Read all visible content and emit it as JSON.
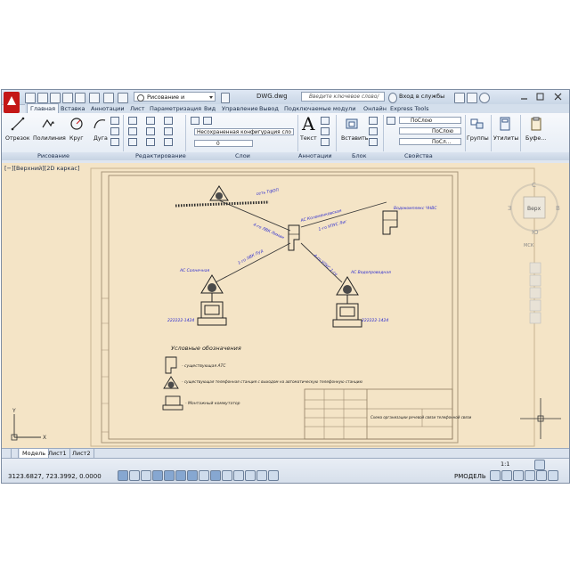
{
  "window": {
    "document_title": "DWG.dwg",
    "workspace": "Рисование и аннотации",
    "search_placeholder": "Введите ключевое слово/фразу",
    "login": "Вход в службы"
  },
  "tabs": [
    "Главная",
    "Вставка",
    "Аннотации",
    "Лист",
    "Параметризация",
    "Вид",
    "Управление",
    "Вывод",
    "Подключаемые модули",
    "Онлайн",
    "Express Tools"
  ],
  "ribbon": {
    "draw_tools": [
      "Отрезок",
      "Полилиния",
      "Круг",
      "Дуга"
    ],
    "layer_combo": "Несохраненная конфигурация сло",
    "layer_current": "0",
    "text_button": "Текст",
    "insert_button": "Вставить",
    "color_combo": "ПоСлою",
    "linetype_combo": "ПоСлою",
    "lineweight_combo": "ПоСл...",
    "groups_button": "Группы",
    "utilities_button": "Утилиты",
    "clipboard_button": "Буфе...",
    "panels": [
      "Рисование",
      "Редактирование",
      "Слои",
      "Аннотации",
      "Блок",
      "Свойства"
    ]
  },
  "viewport": {
    "label": "[−][Верхний][2D каркас]",
    "viewcube_top": "Верх",
    "viewcube_north": "С",
    "viewcube_south": "Ю",
    "viewcube_west": "З",
    "viewcube_east": "В",
    "wcs": "МСК"
  },
  "drawing": {
    "labels": {
      "net": "сеть ТфОП",
      "kolomenka": "АС Коломенковская",
      "vodokomp": "Водокомплекс ЧНВС",
      "solnechn": "АС Солнечная",
      "vodoprovod": "АС Водопроводная",
      "pc1": "222222-1424",
      "pc2": "222222-1424",
      "l1": "4-го ЛВК Лиман",
      "l2": "1-го УПУС Лиг",
      "l3": "1-го ЛВК Луд",
      "l4": "4-го УПУС 1-го"
    },
    "legend": {
      "title": "Условные обозначения",
      "item1": "- существующая АТС",
      "item2": "- существующая телефонная станция с выходом на автоматическую телефонную станцию",
      "item3": "- Монтажный коммутатор"
    },
    "stamp_text": "Схема организации речевой связи телефонной связи"
  },
  "layout_tabs": [
    "Модель",
    "Лист1",
    "Лист2"
  ],
  "status": {
    "coords": "3123.6827, 723.3992, 0.0000",
    "model": "РМОДЕЛЬ",
    "scale": "1:1"
  },
  "colors": {
    "canvas": "#f4e4c6",
    "ribbon": "#e9eef5",
    "accent": "#c41717",
    "annotation_text": "#2a2ad0"
  }
}
